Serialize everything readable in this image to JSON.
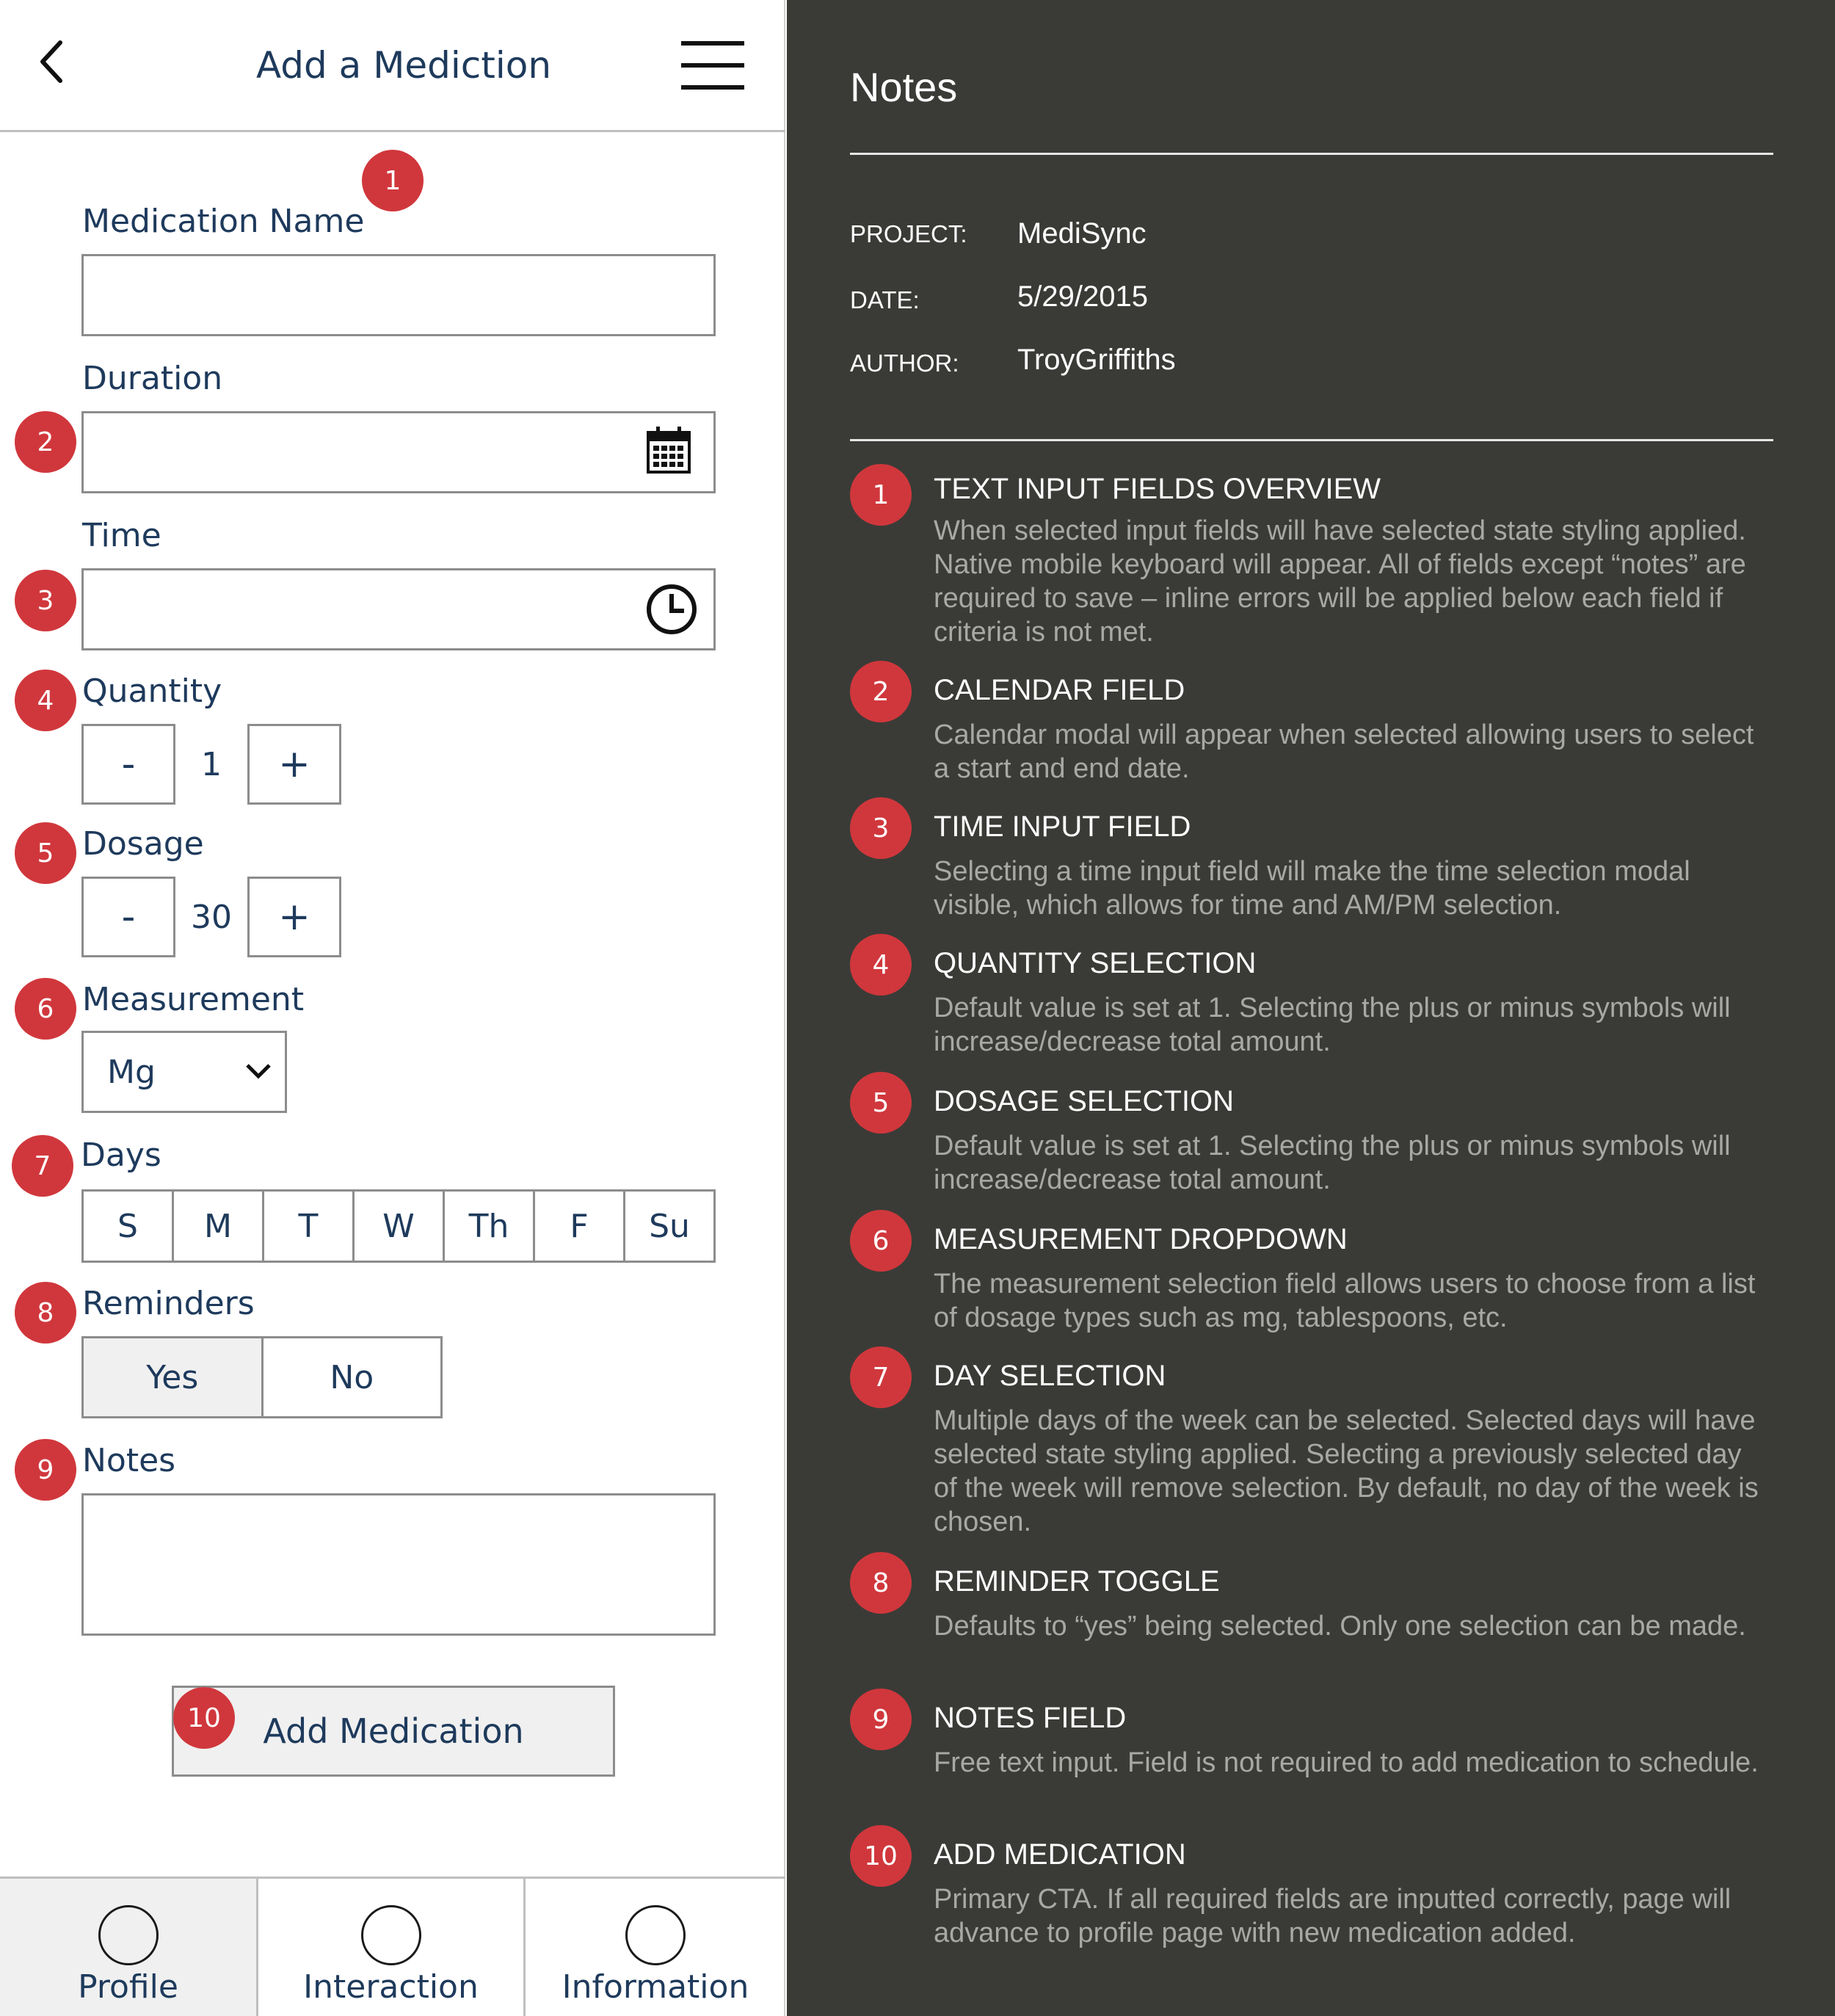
{
  "header": {
    "title": "Add a Mediction"
  },
  "form": {
    "medication_name_label": "Medication Name",
    "duration_label": "Duration",
    "time_label": "Time",
    "quantity_label": "Quantity",
    "quantity_minus": "-",
    "quantity_value": "1",
    "quantity_plus": "+",
    "dosage_label": "Dosage",
    "dosage_minus": "-",
    "dosage_value": "30",
    "dosage_plus": "+",
    "measurement_label": "Measurement",
    "measurement_value": "Mg",
    "days_label": "Days",
    "days": [
      "S",
      "M",
      "T",
      "W",
      "Th",
      "F",
      "Su"
    ],
    "reminders_label": "Reminders",
    "reminders_yes": "Yes",
    "reminders_no": "No",
    "notes_label": "Notes",
    "add_button": "Add Medication"
  },
  "badges": [
    "1",
    "2",
    "3",
    "4",
    "5",
    "6",
    "7",
    "8",
    "9",
    "10"
  ],
  "tabs": [
    "Profile",
    "Interaction",
    "Information"
  ],
  "notes_panel": {
    "title": "Notes",
    "project_key": "PROJECT:",
    "project_value": "MediSync",
    "date_key": "DATE:",
    "date_value": "5/29/2015",
    "author_key": "AUTHOR:",
    "author_value": "TroyGriffiths",
    "items": [
      {
        "num": "1",
        "title": "TEXT INPUT FIELDS OVERVIEW",
        "body": "When selected input fields will have selected state styling applied. Native mobile keyboard will appear. All of fields except “notes” are required to save – inline errors will be applied below each field if criteria is not met."
      },
      {
        "num": "2",
        "title": "CALENDAR FIELD",
        "body": "Calendar modal will appear when selected allowing users to select a start and end date."
      },
      {
        "num": "3",
        "title": "TIME INPUT FIELD",
        "body": "Selecting a time input field will make the time selection modal visible, which allows for time and AM/PM selection."
      },
      {
        "num": "4",
        "title": "QUANTITY SELECTION",
        "body": "Default value is set at 1. Selecting the plus or minus symbols will increase/decrease total amount."
      },
      {
        "num": "5",
        "title": "DOSAGE SELECTION",
        "body": "Default value is set at 1. Selecting the plus or minus symbols will increase/decrease total amount."
      },
      {
        "num": "6",
        "title": "MEASUREMENT DROPDOWN",
        "body": "The measurement selection field allows users to choose from a list of dosage types such as mg, tablespoons, etc."
      },
      {
        "num": "7",
        "title": "DAY SELECTION",
        "body": "Multiple days of the week can be selected. Selected days will have selected state styling applied. Selecting a previously selected day of the week will remove selection. By default, no day of the week is chosen."
      },
      {
        "num": "8",
        "title": "REMINDER TOGGLE",
        "body": "Defaults to “yes” being selected. Only one selection can be made."
      },
      {
        "num": "9",
        "title": "NOTES FIELD",
        "body": "Free text input. Field is not required to add medication to schedule."
      },
      {
        "num": "10",
        "title": "ADD MEDICATION",
        "body": "Primary CTA. If all required fields are inputted correctly, page will advance to profile page with new medication added."
      }
    ]
  },
  "colors": {
    "badge": "#d0373c",
    "notes_bg": "#3a3b37",
    "text_navy": "#1e3a5c"
  }
}
